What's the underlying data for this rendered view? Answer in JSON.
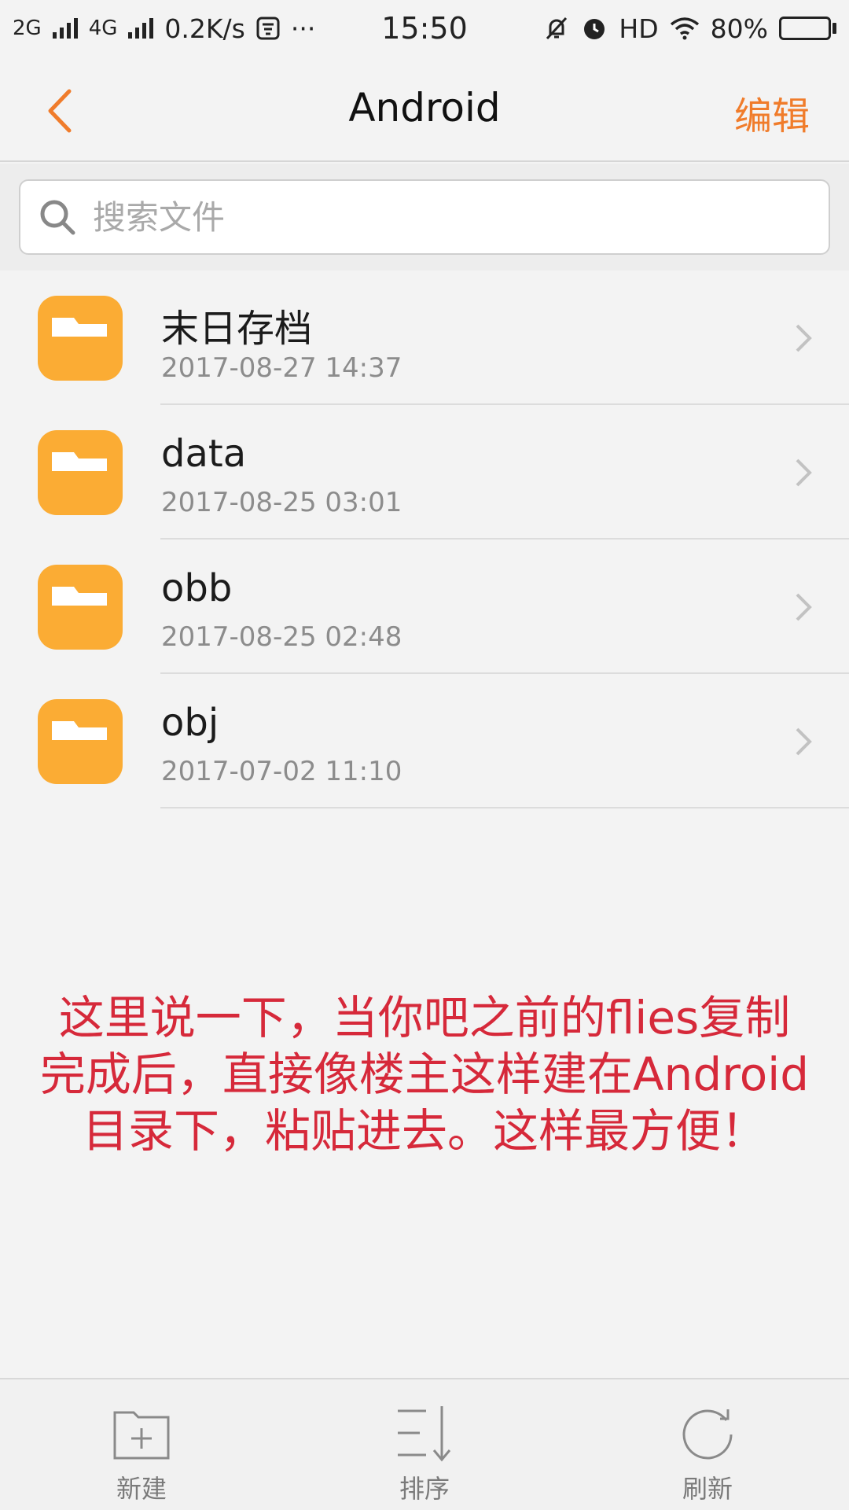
{
  "status_bar": {
    "net1": "2G",
    "net2": "4G",
    "speed": "0.2K/s",
    "more": "···",
    "time": "15:50",
    "hd": "HD",
    "battery_text": "80%",
    "battery_level": 0.8,
    "icons": [
      "signal-2g-icon",
      "signal-4g-icon",
      "app-notification-icon",
      "mute-icon",
      "alarm-icon",
      "wifi-icon",
      "battery-icon"
    ]
  },
  "nav": {
    "title": "Android",
    "edit_label": "编辑",
    "back_icon": "chevron-left-icon"
  },
  "search": {
    "placeholder": "搜索文件",
    "value": ""
  },
  "files": [
    {
      "name": "末日存档",
      "date": "2017-08-27 14:37",
      "icon": "folder-icon"
    },
    {
      "name": "data",
      "date": "2017-08-25 03:01",
      "icon": "folder-icon"
    },
    {
      "name": "obb",
      "date": "2017-08-25 02:48",
      "icon": "folder-icon"
    },
    {
      "name": "obj",
      "date": "2017-07-02 11:10",
      "icon": "folder-icon"
    }
  ],
  "annotation": {
    "line1": "这里说一下，当你吧之前的flies复制",
    "line2": "完成后，直接像楼主这样建在Android",
    "line3": "目录下，粘贴进去。这样最方便！"
  },
  "toolbar": {
    "new_label": "新建",
    "sort_label": "排序",
    "refresh_label": "刷新"
  },
  "colors": {
    "accent": "#f07c2b",
    "folder": "#fbac34",
    "annotation": "#d6293a"
  }
}
